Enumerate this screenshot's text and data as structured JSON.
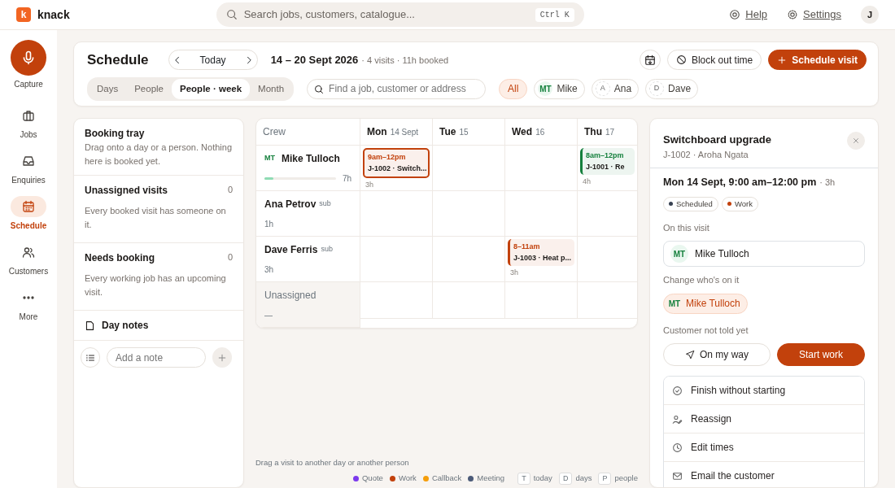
{
  "brand": {
    "initial": "k",
    "name": "knack"
  },
  "search": {
    "placeholder": "Search jobs, customers, catalogue...",
    "shortcut": "Ctrl K"
  },
  "top_links": [
    {
      "label": "Help"
    },
    {
      "label": "Settings"
    }
  ],
  "avatar": "J",
  "nav": [
    {
      "label": "Capture",
      "kind": "primary",
      "selected": false
    },
    {
      "label": "Jobs",
      "kind": "item",
      "selected": false
    },
    {
      "label": "Enquiries",
      "kind": "item",
      "selected": false
    },
    {
      "label": "Schedule",
      "kind": "item",
      "selected": true
    },
    {
      "label": "Customers",
      "kind": "item",
      "selected": false
    },
    {
      "label": "More",
      "kind": "item",
      "selected": false
    }
  ],
  "header": {
    "title": "Schedule",
    "today": "Today",
    "range": "14 – 20 Sept 2026",
    "summary": "· 4 visits · 11h booked",
    "block_out": "Block out time",
    "schedule_visit": "Schedule visit",
    "views": [
      {
        "label": "Days",
        "selected": false
      },
      {
        "label": "People",
        "selected": false
      },
      {
        "label": "People · week",
        "selected": true
      },
      {
        "label": "Month",
        "selected": false
      }
    ],
    "filter_placeholder": "Find a job, customer or address",
    "people": [
      {
        "label": "All",
        "selected": true
      },
      {
        "label": "Mike",
        "initials": "MT",
        "selected": false
      },
      {
        "label": "Ana",
        "initials": "A",
        "selected": false
      },
      {
        "label": "Dave",
        "initials": "D",
        "selected": false
      }
    ]
  },
  "tray": {
    "title": "Booking tray",
    "hint": "Drag onto a day or a person. Nothing here is booked yet.",
    "sections": [
      {
        "title": "Unassigned visits",
        "count": "0",
        "text": "Every booked visit has someone on it."
      },
      {
        "title": "Needs booking",
        "count": "0",
        "text": "Every working job has an upcoming visit."
      }
    ],
    "notes_title": "Day notes",
    "note_placeholder": "Add a note"
  },
  "grid": {
    "crew_heading": "Crew",
    "days": [
      {
        "name": "Mon",
        "date": "14",
        "month": "Sept"
      },
      {
        "name": "Tue",
        "date": "15"
      },
      {
        "name": "Wed",
        "date": "16"
      },
      {
        "name": "Thu",
        "date": "17"
      }
    ],
    "crew": [
      {
        "initials": "MT",
        "name": "Mike Tulloch",
        "hours": "7h",
        "level": 0.12,
        "unassigned": false,
        "cells": [
          {
            "kind": "visit",
            "time": "9am–12pm",
            "title": "J-1002 · Switch...",
            "duration": "3h",
            "color": "#c2410c",
            "selected": true
          },
          {
            "kind": "empty"
          },
          {
            "kind": "empty"
          },
          {
            "kind": "visit",
            "time": "8am–12pm",
            "title": "J-1001 · Re",
            "duration": "4h",
            "color": "#15803d",
            "selected": false
          }
        ]
      },
      {
        "name": "Ana Petrov",
        "tag": "sub",
        "hours": "1h",
        "unassigned": false,
        "cells": [
          {
            "kind": "empty"
          },
          {
            "kind": "empty"
          },
          {
            "kind": "empty"
          },
          {
            "kind": "empty"
          }
        ]
      },
      {
        "name": "Dave Ferris",
        "tag": "sub",
        "hours": "3h",
        "unassigned": false,
        "cells": [
          {
            "kind": "empty"
          },
          {
            "kind": "empty"
          },
          {
            "kind": "visit",
            "time": "8–11am",
            "title": "J-1003 · Heat p...",
            "duration": "3h",
            "color": "#c2410c",
            "selected": false
          },
          {
            "kind": "empty"
          }
        ]
      },
      {
        "name": "Unassigned",
        "hours": "—",
        "unassigned": true,
        "cells": [
          {
            "kind": "empty"
          },
          {
            "kind": "empty"
          },
          {
            "kind": "empty"
          },
          {
            "kind": "empty"
          }
        ]
      }
    ],
    "hint": "Drag a visit to another day or another person",
    "legend": [
      {
        "label": "Quote",
        "color": "#7c3aed"
      },
      {
        "label": "Work",
        "color": "#c2410c"
      },
      {
        "label": "Callback",
        "color": "#f59e0b"
      },
      {
        "label": "Meeting",
        "color": "#4b5a78"
      }
    ],
    "shortcuts": [
      {
        "key": "T",
        "label": "today"
      },
      {
        "key": "D",
        "label": "days"
      },
      {
        "key": "P",
        "label": "people"
      }
    ]
  },
  "detail": {
    "title": "Switchboard upgrade",
    "subtitle": "J-1002 · Aroha Ngata",
    "when": "Mon 14 Sept, 9:00 am–12:00 pm",
    "duration": "· 3h",
    "tags": [
      {
        "label": "Scheduled",
        "color": "#374151"
      },
      {
        "label": "Work",
        "color": "#c2410c"
      }
    ],
    "on_visit_label": "On this visit",
    "on_visit": {
      "initials": "MT",
      "name": "Mike Tulloch"
    },
    "change_label": "Change who's on it",
    "chips": [
      {
        "initials": "MT",
        "name": "Mike Tulloch",
        "selected": true
      }
    ],
    "notice": "Customer not told yet",
    "secondary": "On my way",
    "primary": "Start work",
    "actions": [
      "Finish without starting",
      "Reassign",
      "Edit times",
      "Email the customer"
    ]
  }
}
